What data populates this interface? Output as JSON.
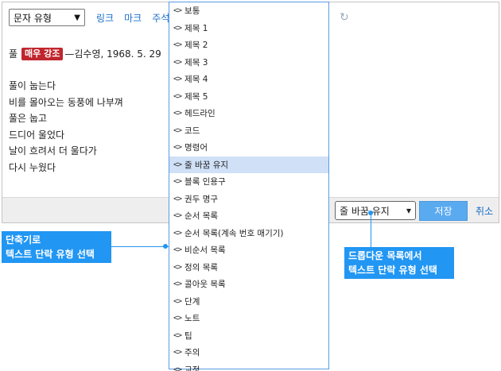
{
  "toolbar": {
    "type_select_value": "문자 유형",
    "links": [
      "링크",
      "마크",
      "주석"
    ]
  },
  "content": {
    "title": "풀",
    "badge": "매우 강조",
    "attribution": "—김수영, 1968. 5. 29",
    "poem_lines": [
      "풀이 눕는다",
      "비를 몰아오는 동풍에 나부껴",
      "풀은 눕고",
      "드디어 울었다",
      "날이 흐려서 더 울다가",
      "다시 누웠다"
    ]
  },
  "footer": {
    "select_value": "줄 바꿈 유지",
    "save_label": "저장",
    "cancel_label": "취소"
  },
  "dropdown": {
    "bracket": "<>",
    "items": [
      "보통",
      "제목 1",
      "제목 2",
      "제목 3",
      "제목 4",
      "제목 5",
      "헤드라인",
      "코드",
      "명령어",
      "줄 바꿈 유지",
      "블록 인용구",
      "권두 명구",
      "순서 목록",
      "순서 목록(계속 번호 매기기)",
      "비순서 목록",
      "정의 목록",
      "콜아웃 목록",
      "단계",
      "노트",
      "팁",
      "주의",
      "교정"
    ],
    "selected_index": 9
  },
  "callouts": {
    "left": [
      "단축기로",
      "텍스트 단락 유형 선택"
    ],
    "right": [
      "드롭다운 목록에서",
      "텍스트 단락 유형 선택"
    ],
    "color": "#2196f3"
  }
}
